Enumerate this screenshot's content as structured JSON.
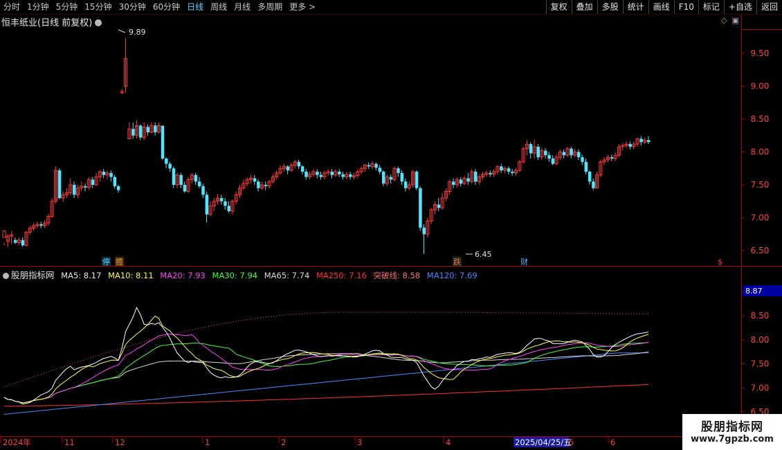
{
  "toolbar": {
    "periods": [
      "分时",
      "1分钟",
      "5分钟",
      "15分钟",
      "30分钟",
      "60分钟",
      "日线",
      "周线",
      "月线",
      "多周期",
      "更多 >"
    ],
    "active_period": "日线",
    "right_buttons": [
      "复权",
      "叠加",
      "多股",
      "统计",
      "画线",
      "F10",
      "标记",
      "+自选",
      "返回"
    ]
  },
  "stock": {
    "title": "恒丰纸业(日线 前复权)"
  },
  "price_axis": {
    "labels": [
      "9.50",
      "9.00",
      "8.50",
      "8.00",
      "7.50",
      "7.00",
      "6.50"
    ]
  },
  "annotations": {
    "high": "9.89",
    "low": "6.45",
    "markers": [
      "停",
      "揽",
      "跌",
      "财",
      "$"
    ]
  },
  "indicator": {
    "name": "股朋指标网",
    "ma5_label": "MA5: 8.17",
    "ma10_label": "MA10: 8.11",
    "ma20_label": "MA20: 7.93",
    "ma30_label": "MA30: 7.94",
    "ma65_label": "MA65: 7.74",
    "ma250_label": "MA250: 7.16",
    "breakout_label": "突破线: 8.58",
    "ma120_label": "MA120: 7.69",
    "axis_labels": [
      "8.50",
      "8.00",
      "7.50",
      "7.00",
      "6.50"
    ],
    "current_value": "8.87"
  },
  "date_axis": {
    "labels": [
      "2024年",
      "11",
      "12",
      "1",
      "2",
      "3",
      "4",
      "5",
      "6"
    ],
    "cursor_date": "2025/04/25/五"
  },
  "watermark": {
    "line1": "股朋指标网",
    "line2": "www.7gpzb.com"
  },
  "colors": {
    "up": "#ff3a3a",
    "down": "#4de8ff",
    "axis": "#b00000",
    "ma5": "#ffffff",
    "ma10": "#ffff40",
    "ma20": "#ff40ff",
    "ma30": "#40ff40",
    "ma65": "#d8d8d8",
    "ma250": "#ff3030",
    "breakout": "#ff6060",
    "ma120": "#4a8cff"
  },
  "chart_data": {
    "type": "candlestick",
    "title": "恒丰纸业(日线 前复权)",
    "ylim": [
      6.35,
      10.05
    ],
    "candles": [
      [
        6.7,
        6.8,
        6.62,
        6.58
      ],
      [
        6.64,
        6.72,
        6.75,
        6.55
      ],
      [
        6.72,
        6.74,
        6.8,
        6.6
      ],
      [
        6.66,
        6.62,
        6.7,
        6.6
      ],
      [
        6.62,
        6.66,
        6.7,
        6.58
      ],
      [
        6.66,
        6.58,
        6.7,
        6.56
      ],
      [
        6.58,
        6.78,
        6.8,
        6.56
      ],
      [
        6.78,
        6.84,
        6.88,
        6.74
      ],
      [
        6.84,
        6.88,
        6.92,
        6.8
      ],
      [
        6.88,
        6.9,
        6.94,
        6.84
      ],
      [
        6.9,
        6.88,
        6.94,
        6.84
      ],
      [
        6.88,
        6.92,
        6.96,
        6.84
      ],
      [
        6.92,
        7.02,
        7.06,
        6.88
      ],
      [
        7.02,
        7.25,
        7.3,
        7.0
      ],
      [
        7.25,
        7.72,
        7.78,
        7.22
      ],
      [
        7.72,
        7.3,
        7.75,
        7.28
      ],
      [
        7.3,
        7.35,
        7.4,
        7.24
      ],
      [
        7.35,
        7.38,
        7.45,
        7.3
      ],
      [
        7.38,
        7.5,
        7.6,
        7.34
      ],
      [
        7.5,
        7.35,
        7.55,
        7.3
      ],
      [
        7.35,
        7.45,
        7.5,
        7.3
      ],
      [
        7.45,
        7.48,
        7.55,
        7.4
      ],
      [
        7.48,
        7.46,
        7.52,
        7.4
      ],
      [
        7.46,
        7.58,
        7.62,
        7.42
      ],
      [
        7.58,
        7.5,
        7.62,
        7.45
      ],
      [
        7.5,
        7.62,
        7.68,
        7.48
      ],
      [
        7.62,
        7.7,
        7.72,
        7.55
      ],
      [
        7.7,
        7.65,
        7.74,
        7.6
      ],
      [
        7.65,
        7.68,
        7.72,
        7.58
      ],
      [
        7.68,
        7.62,
        7.72,
        7.55
      ],
      [
        7.62,
        7.48,
        7.65,
        7.44
      ],
      [
        7.48,
        7.42,
        7.5,
        7.38
      ],
      [
        8.9,
        8.92,
        8.96,
        8.88
      ],
      [
        9.0,
        9.42,
        9.73,
        8.9
      ],
      [
        8.2,
        8.35,
        8.45,
        8.2
      ],
      [
        8.35,
        8.25,
        8.45,
        8.2
      ],
      [
        8.25,
        8.4,
        8.48,
        8.2
      ],
      [
        8.4,
        8.22,
        8.42,
        8.18
      ],
      [
        8.22,
        8.38,
        8.45,
        8.18
      ],
      [
        8.38,
        8.3,
        8.42,
        8.25
      ],
      [
        8.3,
        8.4,
        8.45,
        8.28
      ],
      [
        8.4,
        8.3,
        8.45,
        8.25
      ],
      [
        8.3,
        8.4,
        8.45,
        8.28
      ],
      [
        8.4,
        7.9,
        8.4,
        7.88
      ],
      [
        7.9,
        7.82,
        7.92,
        7.75
      ],
      [
        7.82,
        7.75,
        7.85,
        7.7
      ],
      [
        7.75,
        7.5,
        7.78,
        7.45
      ],
      [
        7.5,
        7.65,
        7.68,
        7.45
      ],
      [
        7.65,
        7.5,
        7.68,
        7.45
      ],
      [
        7.5,
        7.4,
        7.55,
        7.38
      ],
      [
        7.4,
        7.58,
        7.62,
        7.38
      ],
      [
        7.58,
        7.65,
        7.68,
        7.52
      ],
      [
        7.65,
        7.55,
        7.68,
        7.5
      ],
      [
        7.55,
        7.48,
        7.62,
        7.45
      ],
      [
        7.48,
        7.35,
        7.52,
        7.3
      ],
      [
        7.35,
        7.05,
        7.4,
        6.93
      ],
      [
        7.05,
        7.18,
        7.25,
        7.02
      ],
      [
        7.18,
        7.25,
        7.3,
        7.1
      ],
      [
        7.25,
        7.3,
        7.36,
        7.2
      ],
      [
        7.3,
        7.25,
        7.35,
        7.2
      ],
      [
        7.25,
        7.18,
        7.3,
        7.12
      ],
      [
        7.18,
        7.1,
        7.25,
        7.08
      ],
      [
        7.1,
        7.25,
        7.28,
        7.05
      ],
      [
        7.25,
        7.35,
        7.4,
        7.2
      ],
      [
        7.35,
        7.45,
        7.5,
        7.3
      ],
      [
        7.45,
        7.52,
        7.58,
        7.42
      ],
      [
        7.52,
        7.58,
        7.62,
        7.48
      ],
      [
        7.58,
        7.6,
        7.65,
        7.52
      ],
      [
        7.6,
        7.55,
        7.65,
        7.5
      ],
      [
        7.55,
        7.45,
        7.58,
        7.4
      ],
      [
        7.45,
        7.5,
        7.55,
        7.42
      ],
      [
        7.5,
        7.48,
        7.55,
        7.42
      ],
      [
        7.48,
        7.55,
        7.58,
        7.44
      ],
      [
        7.55,
        7.62,
        7.66,
        7.52
      ],
      [
        7.62,
        7.68,
        7.72,
        7.58
      ],
      [
        7.68,
        7.75,
        7.8,
        7.65
      ],
      [
        7.75,
        7.78,
        7.82,
        7.7
      ],
      [
        7.78,
        7.72,
        7.8,
        7.66
      ],
      [
        7.72,
        7.8,
        7.84,
        7.7
      ],
      [
        7.8,
        7.85,
        7.88,
        7.75
      ],
      [
        7.85,
        7.78,
        7.88,
        7.74
      ],
      [
        7.78,
        7.7,
        7.8,
        7.66
      ],
      [
        7.7,
        7.62,
        7.74,
        7.58
      ],
      [
        7.62,
        7.66,
        7.7,
        7.58
      ],
      [
        7.66,
        7.7,
        7.74,
        7.62
      ],
      [
        7.7,
        7.65,
        7.74,
        7.6
      ],
      [
        7.65,
        7.62,
        7.7,
        7.58
      ],
      [
        7.62,
        7.68,
        7.72,
        7.58
      ],
      [
        7.68,
        7.7,
        7.74,
        7.64
      ],
      [
        7.7,
        7.65,
        7.74,
        7.6
      ],
      [
        7.65,
        7.7,
        7.74,
        7.62
      ],
      [
        7.7,
        7.66,
        7.74,
        7.62
      ],
      [
        7.66,
        7.62,
        7.7,
        7.58
      ],
      [
        7.62,
        7.66,
        7.7,
        7.58
      ],
      [
        7.66,
        7.62,
        7.7,
        7.58
      ],
      [
        7.62,
        7.64,
        7.68,
        7.58
      ],
      [
        7.64,
        7.7,
        7.74,
        7.6
      ],
      [
        7.7,
        7.75,
        7.78,
        7.66
      ],
      [
        7.75,
        7.8,
        7.82,
        7.7
      ],
      [
        7.8,
        7.78,
        7.84,
        7.74
      ],
      [
        7.78,
        7.82,
        7.86,
        7.74
      ],
      [
        7.82,
        7.76,
        7.84,
        7.72
      ],
      [
        7.76,
        7.7,
        7.8,
        7.66
      ],
      [
        7.7,
        7.52,
        7.72,
        7.48
      ],
      [
        7.52,
        7.62,
        7.66,
        7.48
      ],
      [
        7.62,
        7.58,
        7.66,
        7.52
      ],
      [
        7.58,
        7.75,
        7.78,
        7.55
      ],
      [
        7.75,
        7.68,
        7.78,
        7.62
      ],
      [
        7.68,
        7.55,
        7.72,
        7.5
      ],
      [
        7.55,
        7.45,
        7.6,
        7.4
      ],
      [
        7.45,
        7.5,
        7.55,
        7.42
      ],
      [
        7.5,
        7.7,
        7.72,
        7.46
      ],
      [
        7.7,
        7.45,
        7.72,
        7.42
      ],
      [
        7.45,
        6.85,
        7.48,
        6.8
      ],
      [
        6.85,
        6.75,
        6.9,
        6.45
      ],
      [
        6.75,
        6.95,
        7.0,
        6.7
      ],
      [
        6.95,
        7.12,
        7.15,
        6.9
      ],
      [
        7.12,
        7.2,
        7.25,
        7.05
      ],
      [
        7.2,
        7.15,
        7.3,
        7.1
      ],
      [
        7.15,
        7.3,
        7.38,
        7.12
      ],
      [
        7.3,
        7.4,
        7.45,
        7.25
      ],
      [
        7.4,
        7.55,
        7.58,
        7.35
      ],
      [
        7.55,
        7.5,
        7.6,
        7.45
      ],
      [
        7.5,
        7.58,
        7.62,
        7.46
      ],
      [
        7.58,
        7.52,
        7.62,
        7.48
      ],
      [
        7.52,
        7.6,
        7.64,
        7.5
      ],
      [
        7.6,
        7.55,
        7.68,
        7.5
      ],
      [
        7.55,
        7.7,
        7.74,
        7.52
      ],
      [
        7.7,
        7.55,
        7.74,
        7.5
      ],
      [
        7.55,
        7.62,
        7.66,
        7.5
      ],
      [
        7.62,
        7.66,
        7.7,
        7.58
      ],
      [
        7.66,
        7.68,
        7.72,
        7.62
      ],
      [
        7.68,
        7.66,
        7.72,
        7.62
      ],
      [
        7.66,
        7.7,
        7.74,
        7.62
      ],
      [
        7.7,
        7.78,
        7.8,
        7.66
      ],
      [
        7.78,
        7.72,
        7.82,
        7.68
      ],
      [
        7.72,
        7.75,
        7.78,
        7.68
      ],
      [
        7.75,
        7.7,
        7.78,
        7.66
      ],
      [
        7.7,
        7.68,
        7.74,
        7.64
      ],
      [
        7.68,
        7.72,
        7.76,
        7.64
      ],
      [
        7.72,
        7.85,
        7.88,
        7.7
      ],
      [
        7.85,
        8.05,
        8.08,
        7.82
      ],
      [
        8.05,
        8.12,
        8.18,
        7.95
      ],
      [
        8.12,
        7.98,
        8.15,
        7.9
      ],
      [
        7.98,
        8.08,
        8.18,
        7.9
      ],
      [
        8.08,
        7.92,
        8.12,
        7.88
      ],
      [
        7.92,
        8.02,
        8.06,
        7.88
      ],
      [
        8.02,
        7.95,
        8.06,
        7.9
      ],
      [
        7.95,
        7.9,
        8.0,
        7.85
      ],
      [
        7.9,
        7.82,
        7.95,
        7.8
      ],
      [
        7.82,
        7.92,
        7.96,
        7.8
      ],
      [
        7.92,
        8.0,
        8.04,
        7.88
      ],
      [
        8.0,
        7.95,
        8.04,
        7.9
      ],
      [
        7.95,
        8.05,
        8.08,
        7.92
      ],
      [
        8.05,
        7.95,
        8.08,
        7.9
      ],
      [
        7.95,
        8.0,
        8.05,
        7.92
      ],
      [
        8.0,
        7.92,
        8.04,
        7.88
      ],
      [
        7.92,
        7.85,
        7.96,
        7.8
      ],
      [
        7.85,
        7.7,
        7.9,
        7.66
      ],
      [
        7.7,
        7.55,
        7.72,
        7.5
      ],
      [
        7.55,
        7.45,
        7.6,
        7.42
      ],
      [
        7.45,
        7.65,
        7.7,
        7.44
      ],
      [
        7.65,
        7.85,
        7.88,
        7.62
      ],
      [
        7.85,
        7.88,
        7.92,
        7.8
      ],
      [
        7.88,
        7.92,
        7.96,
        7.84
      ],
      [
        7.92,
        7.9,
        7.96,
        7.86
      ],
      [
        7.9,
        7.95,
        8.0,
        7.86
      ],
      [
        7.95,
        8.08,
        8.12,
        7.92
      ],
      [
        8.08,
        8.1,
        8.14,
        8.02
      ],
      [
        8.1,
        8.12,
        8.16,
        8.06
      ],
      [
        8.12,
        8.08,
        8.16,
        8.04
      ],
      [
        8.08,
        8.12,
        8.16,
        8.04
      ],
      [
        8.12,
        8.2,
        8.22,
        8.08
      ],
      [
        8.2,
        8.15,
        8.24,
        8.1
      ],
      [
        8.15,
        8.18,
        8.22,
        8.12
      ],
      [
        8.18,
        8.15,
        8.24,
        8.12
      ]
    ]
  }
}
